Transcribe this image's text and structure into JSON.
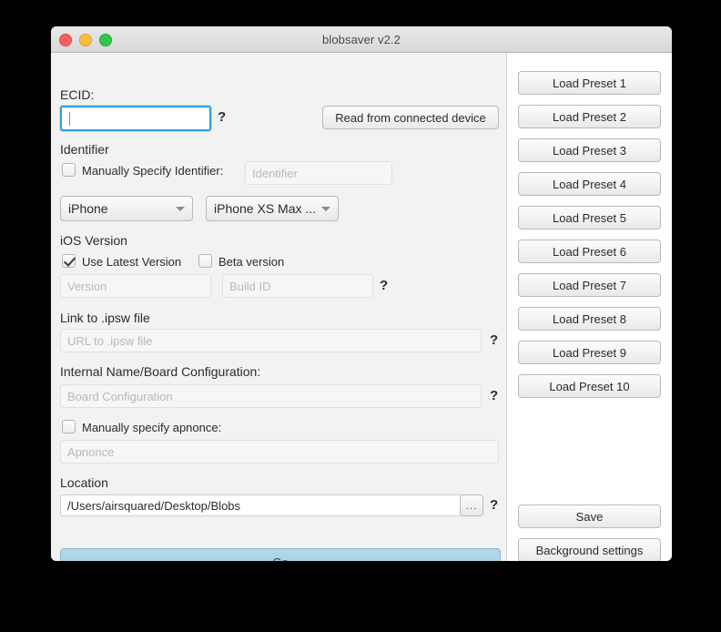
{
  "window": {
    "title": "blobsaver v2.2",
    "traffic_lights": [
      "close-button",
      "minimize-button",
      "maximize-button"
    ],
    "accent_color": "#2d9fdd",
    "go_button_color": "#a8d2e6"
  },
  "form": {
    "ecid": {
      "label": "ECID:",
      "value": "",
      "placeholder": "",
      "help": "?"
    },
    "read_device_button": "Read from connected device",
    "identifier": {
      "section_label": "Identifier",
      "manual_checkbox_label": "Manually Specify Identifier:",
      "manual_checked": false,
      "field_placeholder": "Identifier",
      "field_value": "",
      "device_type": "iPhone",
      "device_model": "iPhone XS Max ..."
    },
    "ios_version": {
      "section_label": "iOS Version",
      "use_latest_label": "Use Latest Version",
      "use_latest_checked": true,
      "beta_label": "Beta version",
      "beta_checked": false,
      "version_placeholder": "Version",
      "version_value": "",
      "build_id_placeholder": "Build ID",
      "build_id_value": "",
      "help": "?"
    },
    "ipsw": {
      "section_label": "Link to .ipsw file",
      "placeholder": "URL to .ipsw file",
      "value": "",
      "help": "?"
    },
    "board_config": {
      "section_label": "Internal Name/Board Configuration:",
      "placeholder": "Board Configuration",
      "value": "",
      "help": "?"
    },
    "apnonce": {
      "checkbox_label": "Manually specify apnonce:",
      "checked": false,
      "placeholder": "Apnonce",
      "value": ""
    },
    "location": {
      "section_label": "Location",
      "value": "/Users/airsquared/Desktop/Blobs",
      "browse_label": "...",
      "help": "?"
    },
    "go_button": "Go"
  },
  "presets": [
    "Load Preset 1",
    "Load Preset 2",
    "Load Preset 3",
    "Load Preset 4",
    "Load Preset 5",
    "Load Preset 6",
    "Load Preset 7",
    "Load Preset 8",
    "Load Preset 9",
    "Load Preset 10"
  ],
  "right_actions": {
    "save": "Save",
    "background_settings": "Background settings"
  }
}
